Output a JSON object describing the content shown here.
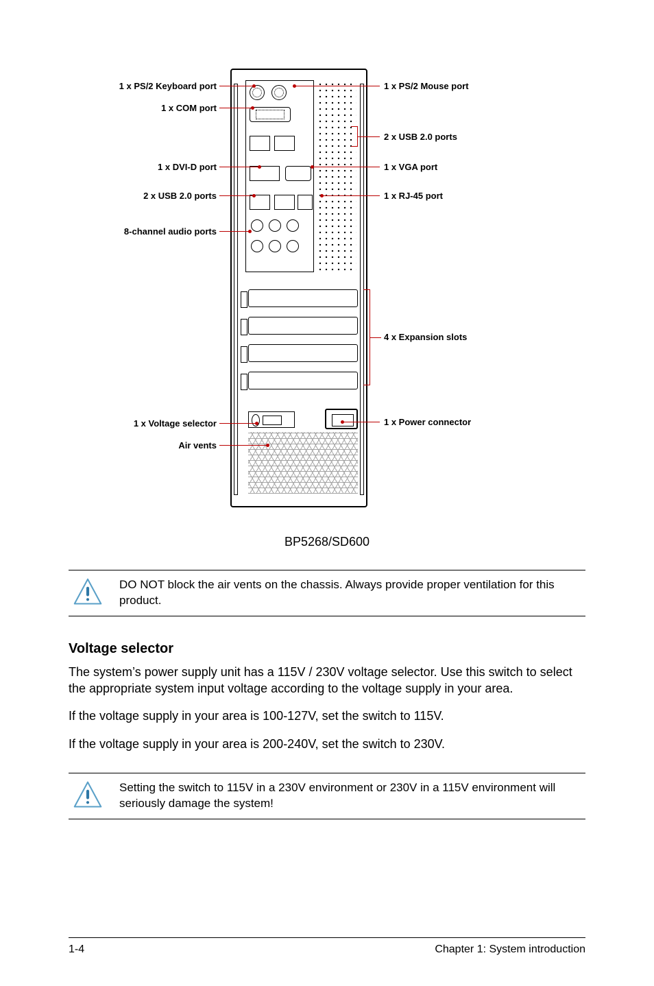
{
  "labels": {
    "left": {
      "ps2_kb": "1 x PS/2 Keyboard port",
      "com": "1 x COM port",
      "dvid": "1 x DVI-D port",
      "usb_a": "2 x USB 2.0 ports",
      "audio": "8-channel audio ports",
      "vsel": "1 x Voltage selector",
      "air": "Air vents"
    },
    "right": {
      "ps2_mouse": "1 x PS/2 Mouse port",
      "usb_b": "2 x USB 2.0 ports",
      "vga": "1 x VGA port",
      "rj45": "1 x RJ-45 port",
      "exp": "4 x Expansion slots",
      "pwr": "1 x Power connector"
    }
  },
  "model": "BP5268/SD600",
  "notes": {
    "vent": "DO NOT block the air vents on the chassis. Always provide proper ventilation for this product.",
    "voltage_warn": "Setting the switch to 115V in a 230V environment or 230V in a 115V environment will seriously damage the system!"
  },
  "section": {
    "title": "Voltage selector",
    "p1": "The system’s power supply unit has a 115V / 230V voltage selector. Use this switch to select the appropriate system input voltage according to the voltage supply in your area.",
    "p2": "If the voltage supply in your area is 100-127V, set the switch to 115V.",
    "p3": "If the voltage supply in your area is 200-240V, set the switch to 230V."
  },
  "footer": {
    "page": "1-4",
    "chapter": "Chapter 1: System introduction"
  }
}
